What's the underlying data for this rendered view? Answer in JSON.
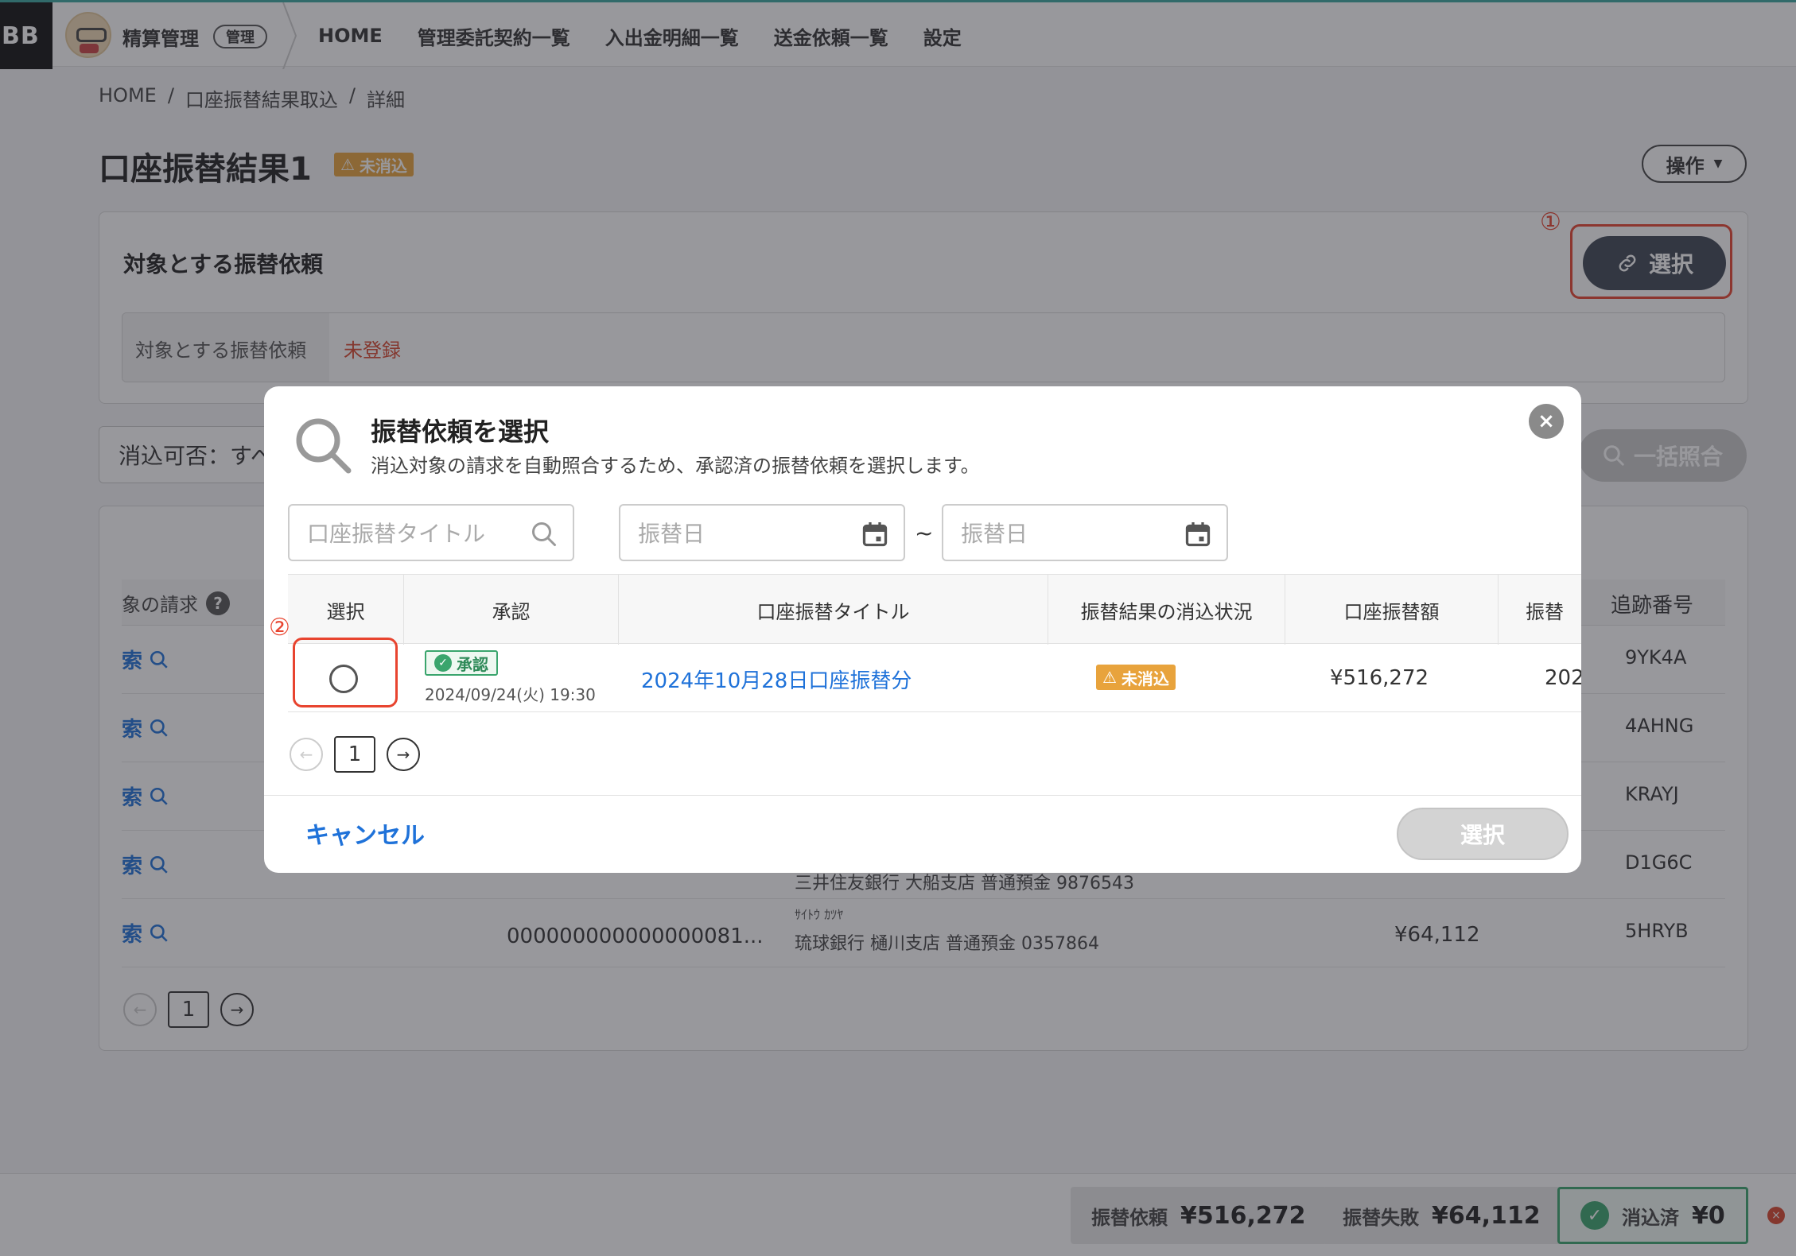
{
  "nav": {
    "logo": "BB",
    "app_title": "精算管理",
    "role_badge": "管理",
    "items": [
      "HOME",
      "管理委託契約一覧",
      "入出金明細一覧",
      "送金依頼一覧",
      "設定"
    ]
  },
  "breadcrumb": [
    "HOME",
    "/",
    "口座振替結果取込",
    "/",
    "詳細"
  ],
  "page": {
    "title": "口座振替結果1",
    "status_badge": "未消込",
    "ops_button": "操作"
  },
  "target_panel": {
    "title": "対象とする振替依頼",
    "select_button": "選択",
    "field_label": "対象とする振替依頼",
    "field_value": "未登録"
  },
  "filter": {
    "select_value": "消込可否：すべて",
    "bulk_button": "一括照合"
  },
  "bg_table": {
    "claim_header": "象の請求",
    "help": "?",
    "track_header": "追跡番号",
    "search_label": "索",
    "rows": [
      {
        "track": "9YK4A",
        "code": "",
        "kana": "",
        "bank": "",
        "amount": ""
      },
      {
        "track": "4AHNG",
        "code": "",
        "kana": "",
        "bank": "",
        "amount": ""
      },
      {
        "track": "KRAYJ",
        "code": "",
        "kana": "",
        "bank": "",
        "amount": ""
      },
      {
        "track": "D1G6C",
        "code": "",
        "kana": "",
        "bank": "三井住友銀行 大船支店 普通預金 9876543",
        "amount": ""
      },
      {
        "track": "5HRYB",
        "code": "000000000000000081...",
        "kana": "ｻｲﾄｳ ｶﾂﾔ",
        "bank": "琉球銀行 樋川支店 普通預金 0357864",
        "amount": "¥64,112"
      }
    ],
    "page": "1"
  },
  "footer": {
    "request_label": "振替依頼",
    "request_value": "¥516,272",
    "failed_label": "振替失敗",
    "failed_value": "¥64,112",
    "done_label": "消込済",
    "done_value": "¥0"
  },
  "callouts": {
    "one": "①",
    "two": "②"
  },
  "modal": {
    "title": "振替依頼を選択",
    "description": "消込対象の請求を自動照合するため、承認済の振替依頼を選択します。",
    "search_placeholder": "口座振替タイトル",
    "date_from_placeholder": "振替日",
    "date_to_placeholder": "振替日",
    "tilde": "~",
    "columns": [
      "選択",
      "承認",
      "口座振替タイトル",
      "振替結果の消込状況",
      "口座振替額",
      "振替"
    ],
    "row": {
      "approved_label": "承認",
      "approved_at": "2024/09/24(火) 19:30",
      "title": "2024年10月28日口座振替分",
      "status": "未消込",
      "amount": "¥516,272",
      "date": "202"
    },
    "page": "1",
    "cancel": "キャンセル",
    "select": "選択"
  },
  "colors": {
    "accent_link": "#1f72d9",
    "warning": "#e8a33c",
    "approved": "#3aa56d",
    "callout": "#e8442f",
    "dark_button": "#3f4553"
  }
}
